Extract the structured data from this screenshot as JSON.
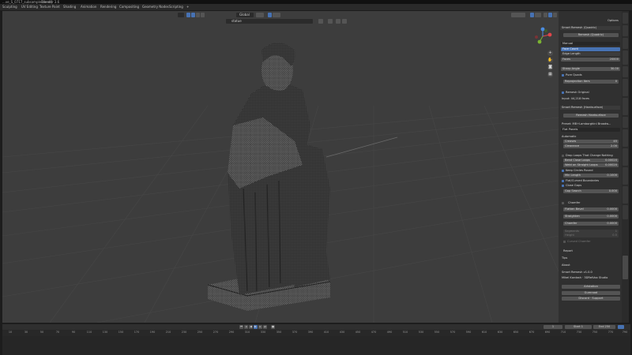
{
  "titlebar": {
    "file": "...ve_S_0717_subsample.blend]",
    "app": "Blender 3.6"
  },
  "menubar": {
    "workspaces": [
      "Sculpting",
      "UV Editing",
      "Texture Paint",
      "Shading",
      "Animation",
      "Rendering",
      "Compositing",
      "Geometry Nodes",
      "Scripting",
      "+"
    ]
  },
  "viewport_header": {
    "orientation": "Global",
    "search": "statue"
  },
  "colors": {
    "viewport_bg": "#3d3d3d",
    "accent": "#4772b3",
    "panel": "#303030"
  },
  "npanel": {
    "toggle": "Options",
    "sr_quadric": {
      "title": "Smart Remesh (Quadric)",
      "button": "Remesh (Quadric)",
      "mode": "Manual",
      "options": [
        "Face Count",
        "Edge Length"
      ],
      "faces_label": "Faces",
      "faces_value": "20000",
      "sharp_label": "Sharp Angle",
      "sharp_value": "30.00",
      "pure_quads": "Pure Quads",
      "reproj_label": "Reprojection Iters",
      "reproj_value": "0",
      "remesh_original": "Remesh Original",
      "input": "Input: 44,218 faces"
    },
    "sr_hard": {
      "title": "Smart Remesh (Hardsurface)",
      "button": "Remesh Hardsurface",
      "preset_label": "Preset: MB+Lamborghini Broadw...",
      "preset_value": "Flat Panels",
      "automatic": "Automatic",
      "creases_label": "Creases",
      "creases_value": "45",
      "clearance_label": "Clearance",
      "clearance_value": "2.00",
      "drop_loops": "Drop Loops That Change Nothing",
      "bend_label": "Bend Close Loops",
      "bend_value": "0.00020",
      "weld_label": "Weld on Straight Loops",
      "weld_value": "0.00020",
      "keep_circles": "Keep Circles Round",
      "min_label": "Min Length",
      "min_value": "0.1000",
      "flat_boundaries": "Flat/Curved Boundaries",
      "close_gaps": "Close Gaps",
      "gap_label": "Gap Search",
      "gap_value": "0.000",
      "chamfer": "Chamfer",
      "flatten_label": "Flatten Bevel",
      "flatten_value": "0.0000",
      "straighten_label": "Straighten",
      "straighten_value": "0.0000",
      "chamfer_label": "Chamfer",
      "chamfer_value": "0.0000",
      "seg_label": "Segments",
      "seg_value": "1",
      "height_label": "Height",
      "height_value": "0.5",
      "curved_chamfer": "Curved Chamfer",
      "report": "Report"
    },
    "tips": "Tips",
    "about": "About",
    "version": "Smart Remesh v1.0.0",
    "author": "Mikel Kardash · 3DRetVox Studio",
    "links": [
      "Artstation",
      "Gumroad",
      "Discord · Support"
    ]
  },
  "vtabs": [
    "Item",
    "Tool",
    "View",
    "Remesh",
    "Edit",
    "BoxCutter",
    "Shortcuts",
    "Gen",
    "Decimate",
    "Randomize",
    "Animation",
    "BlenderKit",
    "HardOps",
    "Smart Remesh"
  ],
  "timeline": {
    "current_frame": "1",
    "start_label": "Start",
    "start_value": "1",
    "end_label": "End",
    "end_value": "250",
    "ruler": [
      "10",
      "30",
      "50",
      "70",
      "90",
      "110",
      "130",
      "150",
      "170",
      "190",
      "210",
      "230",
      "250",
      "270",
      "290",
      "310",
      "330",
      "350",
      "370",
      "390",
      "410",
      "430",
      "450",
      "470",
      "490",
      "510",
      "530",
      "550",
      "570",
      "590",
      "610",
      "630",
      "650",
      "670",
      "690",
      "710",
      "730",
      "750",
      "770",
      "790"
    ]
  }
}
